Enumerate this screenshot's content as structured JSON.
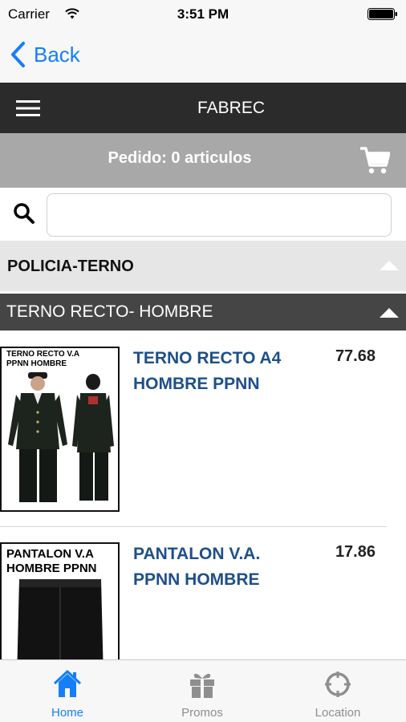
{
  "status_bar": {
    "carrier": "Carrier",
    "time": "3:51 PM"
  },
  "nav": {
    "back_label": "Back"
  },
  "header": {
    "title": "FABREC",
    "menu_icon": "hamburger-menu-icon"
  },
  "order": {
    "text": "Pedido: 0 articulos",
    "cart_icon": "cart-icon"
  },
  "search": {
    "value": "",
    "placeholder": ""
  },
  "category": {
    "label": "POLICIA-TERNO"
  },
  "subcategory": {
    "label": "TERNO RECTO- HOMBRE"
  },
  "products": [
    {
      "name": "TERNO RECTO A4 HOMBRE PPNN",
      "price": "77.68",
      "thumb_caption": "TERNO RECTO V.A PPNN HOMBRE"
    },
    {
      "name": "PANTALON V.A. PPNN HOMBRE",
      "price": "17.86",
      "thumb_caption": "PANTALON V.A HOMBRE PPNN"
    }
  ],
  "tabs": [
    {
      "label": "Home",
      "icon": "home-icon",
      "active": true
    },
    {
      "label": "Promos",
      "icon": "gift-icon",
      "active": false
    },
    {
      "label": "Location",
      "icon": "crosshair-icon",
      "active": false
    }
  ],
  "colors": {
    "accent": "#157efb",
    "header_bg": "#2b2b2b",
    "order_bg": "#a8a8a8",
    "product_name": "#1e4f8a"
  }
}
